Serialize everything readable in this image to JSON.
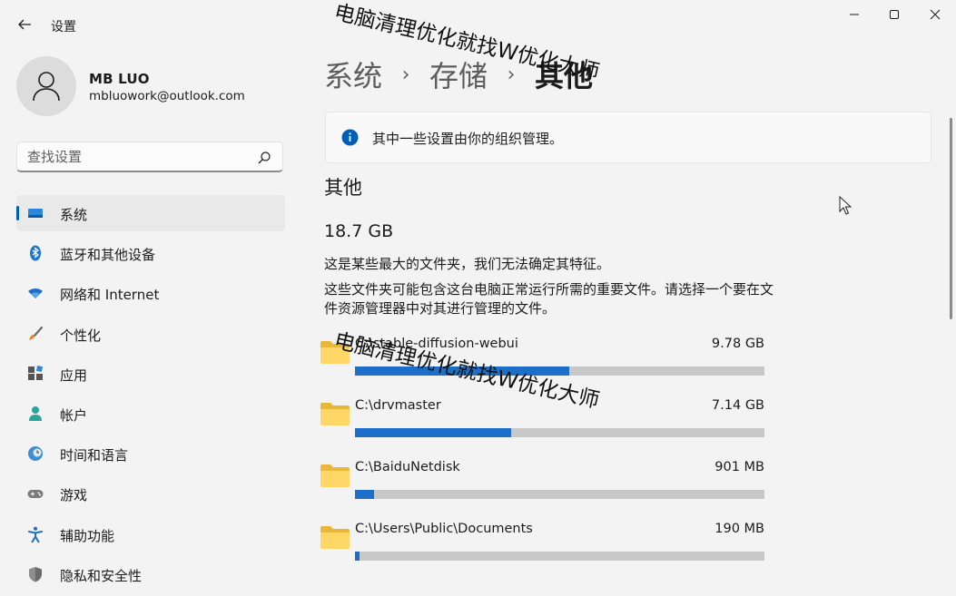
{
  "window": {
    "title": "设置",
    "controls": [
      "minimize",
      "maximize",
      "close"
    ]
  },
  "profile": {
    "name": "MB LUO",
    "email": "mbluowork@outlook.com"
  },
  "search": {
    "placeholder": "查找设置"
  },
  "nav": {
    "items": [
      {
        "label": "系统",
        "icon": "monitor-icon",
        "active": true
      },
      {
        "label": "蓝牙和其他设备",
        "icon": "bluetooth-icon"
      },
      {
        "label": "网络和 Internet",
        "icon": "wifi-icon"
      },
      {
        "label": "个性化",
        "icon": "brush-icon"
      },
      {
        "label": "应用",
        "icon": "apps-icon"
      },
      {
        "label": "帐户",
        "icon": "account-icon"
      },
      {
        "label": "时间和语言",
        "icon": "globe-clock-icon"
      },
      {
        "label": "游戏",
        "icon": "gamepad-icon"
      },
      {
        "label": "辅助功能",
        "icon": "accessibility-icon"
      },
      {
        "label": "隐私和安全性",
        "icon": "shield-icon"
      }
    ]
  },
  "breadcrumb": {
    "items": [
      "系统",
      "存储"
    ],
    "current": "其他",
    "separator": "›"
  },
  "info_banner": {
    "text": "其中一些设置由你的组织管理。"
  },
  "section": {
    "title": "其他",
    "total_size": "18.7 GB",
    "description1": "这是某些最大的文件夹，我们无法确定其特征。",
    "description2": "这些文件夹可能包含这台电脑正常运行所需的重要文件。请选择一个要在文件资源管理器中对其进行管理的文件。"
  },
  "folders": [
    {
      "path": "C:\\stable-diffusion-webui",
      "size": "9.78 GB",
      "fraction": 0.523
    },
    {
      "path": "C:\\drvmaster",
      "size": "7.14 GB",
      "fraction": 0.382
    },
    {
      "path": "C:\\BaiduNetdisk",
      "size": "901 MB",
      "fraction": 0.047
    },
    {
      "path": "C:\\Users\\Public\\Documents",
      "size": "190 MB",
      "fraction": 0.01
    }
  ],
  "watermark": "电脑清理优化就找W优化大师",
  "colors": {
    "accent": "#005fb8",
    "bar_fill": "#1c6fc9",
    "bar_track": "#c8c8c8",
    "background": "#f3f3f3"
  }
}
